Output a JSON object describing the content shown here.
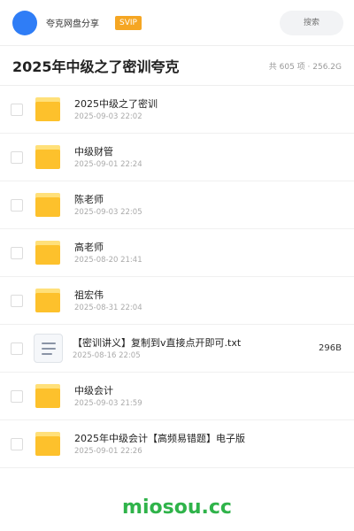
{
  "header": {
    "brand": "夸克网盘分享",
    "badge": "SVIP",
    "search_placeholder": "搜索"
  },
  "titlebar": {
    "title": "2025年中级之了密训夸克",
    "meta": "共 605 项 · 256.2G"
  },
  "files": [
    {
      "type": "folder",
      "name": "2025中级之了密训",
      "date": "2025-09-03 22:02",
      "size": ""
    },
    {
      "type": "folder",
      "name": "中级财管",
      "date": "2025-09-01 22:24",
      "size": ""
    },
    {
      "type": "folder",
      "name": "陈老师",
      "date": "2025-09-03 22:05",
      "size": ""
    },
    {
      "type": "folder",
      "name": "高老师",
      "date": "2025-08-20 21:41",
      "size": ""
    },
    {
      "type": "folder",
      "name": "祖宏伟",
      "date": "2025-08-31 22:04",
      "size": ""
    },
    {
      "type": "txt",
      "name": "【密训讲义】复制到v直接点开即可.txt",
      "date": "2025-08-16 22:05",
      "size": "296B"
    },
    {
      "type": "folder",
      "name": "中级会计",
      "date": "2025-09-03 21:59",
      "size": ""
    },
    {
      "type": "folder",
      "name": "2025年中级会计【高频易错题】电子版",
      "date": "2025-09-01 22:26",
      "size": ""
    }
  ],
  "watermark": "miosou.cc",
  "colors": {
    "accent": "#2f7df6",
    "badge": "#f5a623",
    "folder": "#fdc12c",
    "watermark": "#2fb34a"
  }
}
